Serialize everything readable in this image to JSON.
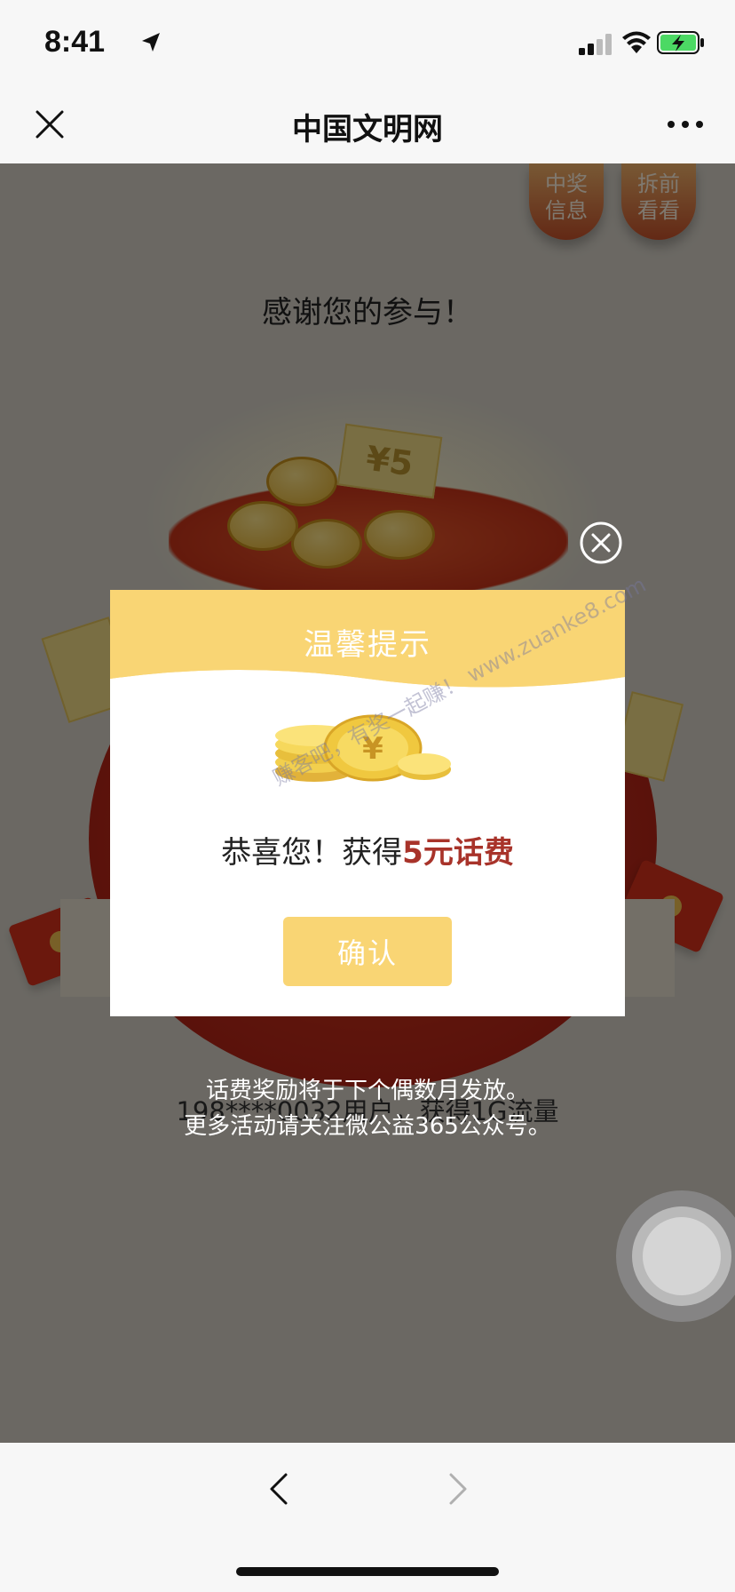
{
  "status_bar": {
    "time": "8:41"
  },
  "nav": {
    "title": "中国文明网"
  },
  "page": {
    "tag_left": "中奖\n信息",
    "tag_right": "拆前\n看看",
    "thanks": "感谢您的参与！",
    "ticket_label": "¥5",
    "winner_line": "198****0032用户，获得1G流量",
    "notice_line1": "话费奖励将于下个偶数月发放。",
    "notice_line2": "更多活动请关注微公益365公众号。"
  },
  "modal": {
    "title": "温馨提示",
    "congrats_prefix": "恭喜您！获得",
    "prize": "5元话费",
    "confirm_label": "确认",
    "watermark": "赚客吧，有奖一起赚！ www.zuanke8.com"
  },
  "colors": {
    "modal_header": "#f9d574",
    "prize_text": "#a8332a",
    "button": "#f9d574"
  }
}
